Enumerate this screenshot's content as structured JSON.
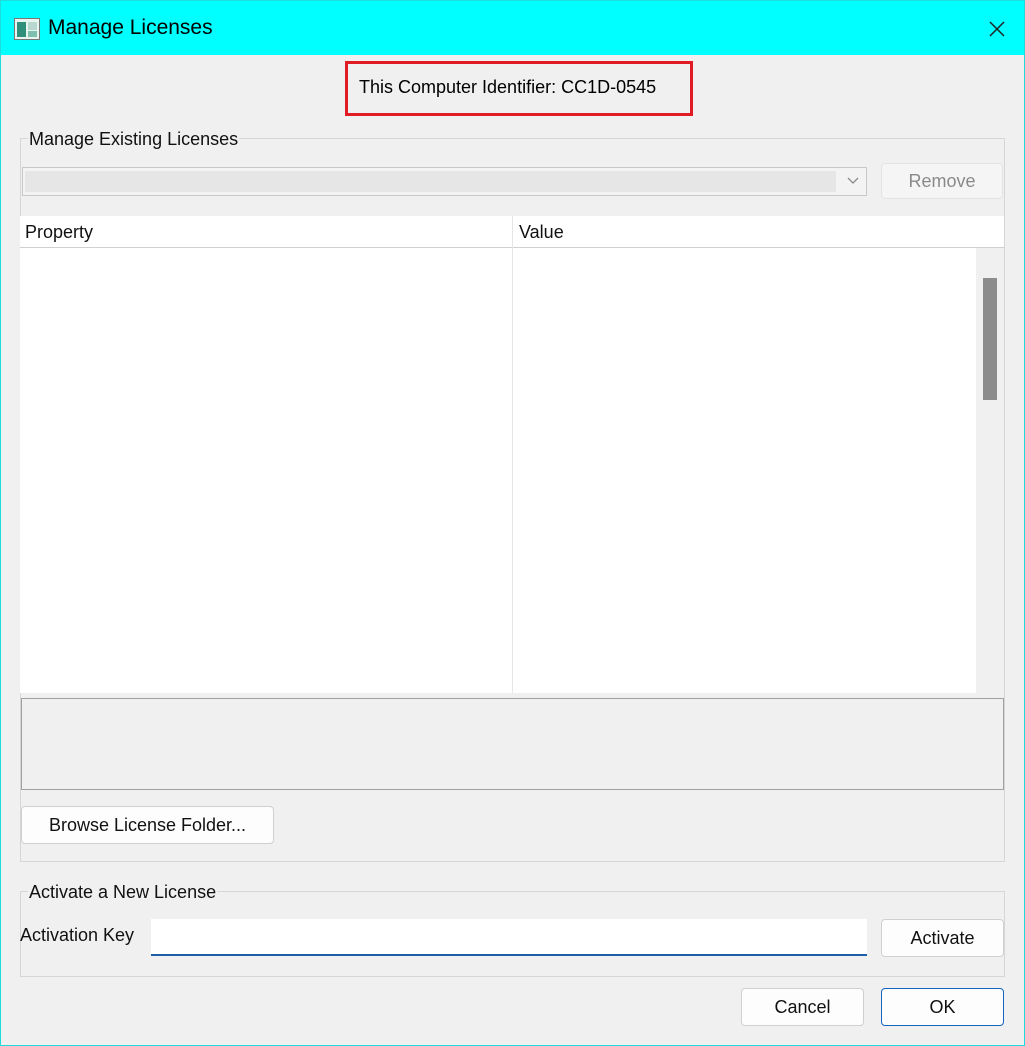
{
  "window": {
    "title": "Manage Licenses",
    "icon": "app-icon",
    "close_icon": "close-icon"
  },
  "computer_id": {
    "text": "This Computer Identifier: CC1D-0545",
    "highlight_color": "#e01b24"
  },
  "existing": {
    "group_label": "Manage Existing Licenses",
    "license_select_value": "",
    "remove_label": "Remove",
    "table": {
      "columns": [
        "Property",
        "Value"
      ],
      "rows": []
    },
    "description": "",
    "browse_label": "Browse License Folder..."
  },
  "new_license": {
    "group_label": "Activate a New License",
    "key_label": "Activation Key",
    "key_value": "",
    "activate_label": "Activate"
  },
  "footer": {
    "cancel_label": "Cancel",
    "ok_label": "OK"
  },
  "colors": {
    "titlebar": "#00ffff",
    "accent": "#1565c0",
    "background": "#f0f0f0"
  }
}
